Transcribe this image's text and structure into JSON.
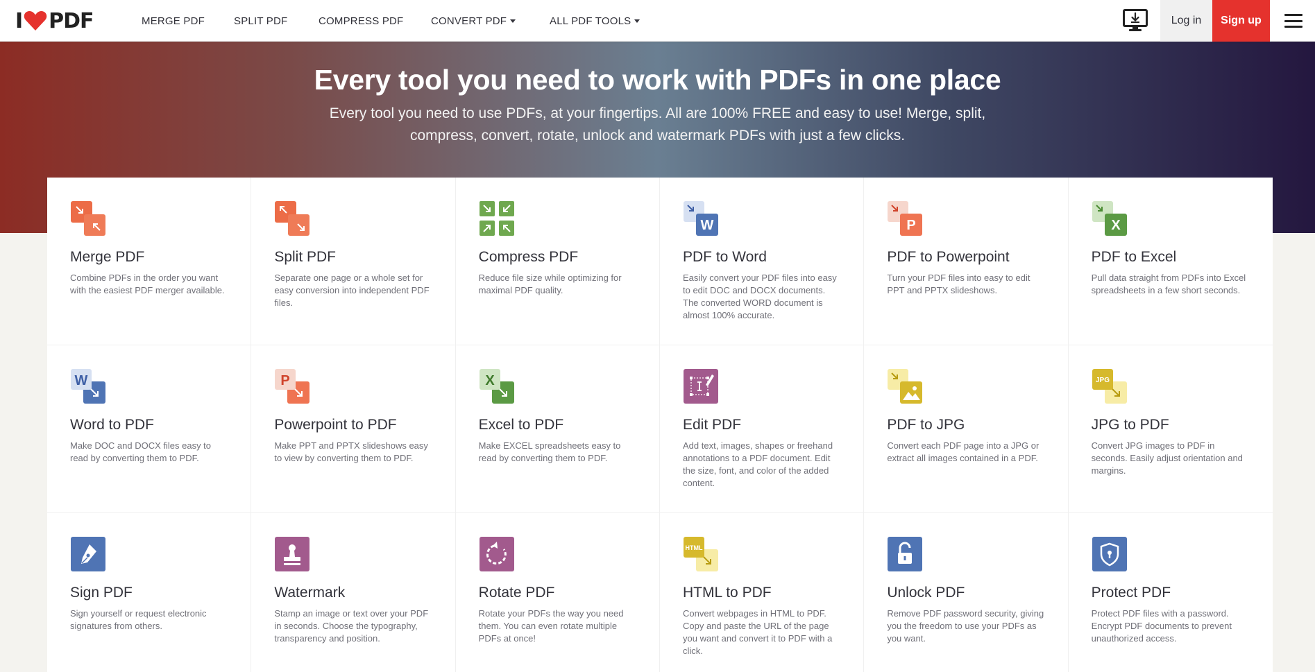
{
  "header": {
    "logo_text_left": "I",
    "logo_text_right": "PDF",
    "nav": [
      {
        "label": "MERGE PDF",
        "dropdown": false
      },
      {
        "label": "SPLIT PDF",
        "dropdown": false
      },
      {
        "label": "COMPRESS PDF",
        "dropdown": false
      },
      {
        "label": "CONVERT PDF",
        "dropdown": true
      },
      {
        "label": "ALL PDF TOOLS",
        "dropdown": true
      }
    ],
    "login_label": "Log in",
    "signup_label": "Sign up",
    "desktop_icon": "desktop-download-icon",
    "menu_icon": "hamburger-menu-icon"
  },
  "hero": {
    "title": "Every tool you need to work with PDFs in one place",
    "subtitle": "Every tool you need to use PDFs, at your fingertips. All are 100% FREE and easy to use! Merge, split, compress, convert, rotate, unlock and watermark PDFs with just a few clicks."
  },
  "colors": {
    "brand_red": "#e5322d",
    "orange": "#e5734a",
    "green": "#6fa84f",
    "blue": "#4f74b4",
    "purple": "#a25a8d",
    "yellow": "#d6b92c"
  },
  "tools": [
    {
      "title": "Merge PDF",
      "desc": "Combine PDFs in the order you want with the easiest PDF merger available.",
      "icon": "merge-icon"
    },
    {
      "title": "Split PDF",
      "desc": "Separate one page or a whole set for easy conversion into independent PDF files.",
      "icon": "split-icon"
    },
    {
      "title": "Compress PDF",
      "desc": "Reduce file size while optimizing for maximal PDF quality.",
      "icon": "compress-icon"
    },
    {
      "title": "PDF to Word",
      "desc": "Easily convert your PDF files into easy to edit DOC and DOCX documents. The converted WORD document is almost 100% accurate.",
      "icon": "pdf-to-word-icon",
      "badge": "W"
    },
    {
      "title": "PDF to Powerpoint",
      "desc": "Turn your PDF files into easy to edit PPT and PPTX slideshows.",
      "icon": "pdf-to-powerpoint-icon",
      "badge": "P"
    },
    {
      "title": "PDF to Excel",
      "desc": "Pull data straight from PDFs into Excel spreadsheets in a few short seconds.",
      "icon": "pdf-to-excel-icon",
      "badge": "X"
    },
    {
      "title": "Word to PDF",
      "desc": "Make DOC and DOCX files easy to read by converting them to PDF.",
      "icon": "word-to-pdf-icon",
      "badge": "W"
    },
    {
      "title": "Powerpoint to PDF",
      "desc": "Make PPT and PPTX slideshows easy to view by converting them to PDF.",
      "icon": "powerpoint-to-pdf-icon",
      "badge": "P"
    },
    {
      "title": "Excel to PDF",
      "desc": "Make EXCEL spreadsheets easy to read by converting them to PDF.",
      "icon": "excel-to-pdf-icon",
      "badge": "X"
    },
    {
      "title": "Edit PDF",
      "desc": "Add text, images, shapes or freehand annotations to a PDF document. Edit the size, font, and color of the added content.",
      "icon": "edit-pdf-icon"
    },
    {
      "title": "PDF to JPG",
      "desc": "Convert each PDF page into a JPG or extract all images contained in a PDF.",
      "icon": "pdf-to-jpg-icon"
    },
    {
      "title": "JPG to PDF",
      "desc": "Convert JPG images to PDF in seconds. Easily adjust orientation and margins.",
      "icon": "jpg-to-pdf-icon",
      "badge": "JPG"
    },
    {
      "title": "Sign PDF",
      "desc": "Sign yourself or request electronic signatures from others.",
      "icon": "sign-pdf-icon"
    },
    {
      "title": "Watermark",
      "desc": "Stamp an image or text over your PDF in seconds. Choose the typography, transparency and position.",
      "icon": "watermark-icon"
    },
    {
      "title": "Rotate PDF",
      "desc": "Rotate your PDFs the way you need them. You can even rotate multiple PDFs at once!",
      "icon": "rotate-pdf-icon"
    },
    {
      "title": "HTML to PDF",
      "desc": "Convert webpages in HTML to PDF. Copy and paste the URL of the page you want and convert it to PDF with a click.",
      "icon": "html-to-pdf-icon",
      "badge": "HTML"
    },
    {
      "title": "Unlock PDF",
      "desc": "Remove PDF password security, giving you the freedom to use your PDFs as you want.",
      "icon": "unlock-pdf-icon"
    },
    {
      "title": "Protect PDF",
      "desc": "Protect PDF files with a password. Encrypt PDF documents to prevent unauthorized access.",
      "icon": "protect-pdf-icon"
    }
  ]
}
